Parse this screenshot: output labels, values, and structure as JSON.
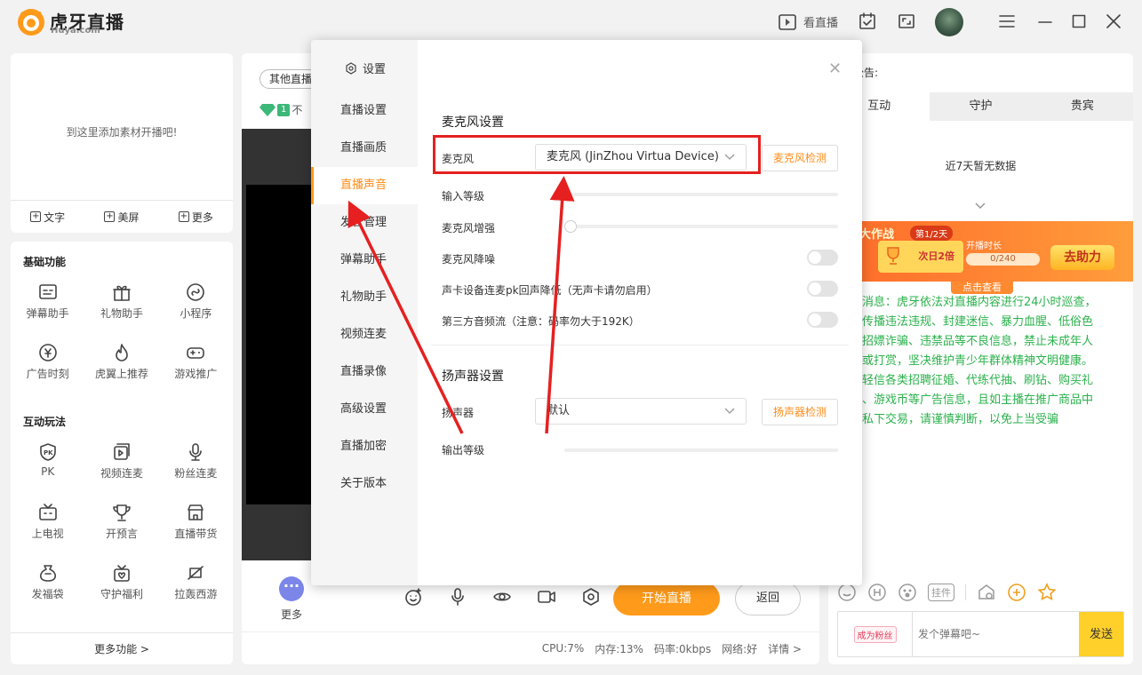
{
  "app": {
    "logo_cn": "虎牙直播",
    "logo_en": "Huya.com",
    "accent": "#ff9a1a"
  },
  "titlebar": {
    "watch_live": "看直播"
  },
  "material": {
    "hint": "到这里添加素材开播吧!",
    "tools": [
      "文字",
      "美屏",
      "更多"
    ]
  },
  "features": {
    "basic_title": "基础功能",
    "basic": [
      {
        "label": "弹幕助手",
        "icon": "danmu-icon"
      },
      {
        "label": "礼物助手",
        "icon": "gift-icon"
      },
      {
        "label": "小程序",
        "icon": "mini-program-icon"
      },
      {
        "label": "广告时刻",
        "icon": "ad-icon"
      },
      {
        "label": "虎翼上推荐",
        "icon": "flame-icon"
      },
      {
        "label": "游戏推广",
        "icon": "gamepad-icon"
      }
    ],
    "interactive_title": "互动玩法",
    "interactive": [
      {
        "label": "PK",
        "icon": "pk-icon"
      },
      {
        "label": "视频连麦",
        "icon": "video-link-icon"
      },
      {
        "label": "粉丝连麦",
        "icon": "mic-icon"
      },
      {
        "label": "上电视",
        "icon": "tv-icon"
      },
      {
        "label": "开预言",
        "icon": "trophy-icon"
      },
      {
        "label": "直播带货",
        "icon": "shop-icon"
      },
      {
        "label": "发福袋",
        "icon": "lucky-bag-icon"
      },
      {
        "label": "守护福利",
        "icon": "guard-gift-icon"
      },
      {
        "label": "拉轰西游",
        "icon": "journey-icon"
      }
    ],
    "more": "更多功能 >"
  },
  "center": {
    "other_live": "其他直播",
    "badge_num": "1",
    "badge_text": "不",
    "more_label": "更多",
    "start_live": "开始直播",
    "return": "返回",
    "status": {
      "cpu": "CPU:7%",
      "mem": "内存:13%",
      "bitrate": "码率:0kbps",
      "network": "网络:好",
      "detail": "详情 >"
    }
  },
  "right": {
    "notice": "公告:",
    "tabs": [
      "互动",
      "守护",
      "贵宾"
    ],
    "nodata": "近7天暂无数据",
    "banner": {
      "title": "福大作战",
      "stage": "第1/2天",
      "double": "次日2倍",
      "time_label": "开播时长",
      "progress_text": "0/240",
      "progress": 0,
      "help": "去助力",
      "click": "点击查看"
    },
    "sys_message": "消息：虎牙依法对直播内容进行24小时巡查，\n传播违法违规、封建迷信、暴力血腥、低俗色\n招嫖诈骗、违禁品等不良信息，禁止未成年人\n或打赏，坚决维护青少年群体精神文明健康。\n轻信各类招聘征婚、代练代抽、刷钻、购买礼\n、游戏币等广告信息，且如主播在推广商品中\n私下交易，请谨慎判断，以免上当受骗",
    "chat": {
      "fans": "成为粉丝",
      "placeholder": "发个弹幕吧~",
      "send": "发送",
      "tool_label": "挂件"
    }
  },
  "dialog": {
    "title": "设置",
    "nav": [
      "直播设置",
      "直播画质",
      "直播声音",
      "发言管理",
      "弹幕助手",
      "礼物助手",
      "视频连麦",
      "直播录像",
      "高级设置",
      "直播加密",
      "关于版本"
    ],
    "active_index": 2,
    "mic_section": "麦克风设置",
    "mic_label": "麦克风",
    "mic_device": "麦克风 (JinZhou Virtua Device)",
    "mic_test": "麦克风检测",
    "input_level": "输入等级",
    "mic_boost": "麦克风增强",
    "mic_boost_value": 0,
    "noise_reduction": "麦克风降噪",
    "noise_reduction_on": false,
    "soundcard": "声卡设备连麦pk回声降低（无声卡请勿启用）",
    "soundcard_on": false,
    "third_party": "第三方音频流（注意：码率勿大于192K）",
    "third_party_on": false,
    "speaker_section": "扬声器设置",
    "speaker_label": "扬声器",
    "speaker_device": "默认",
    "speaker_test": "扬声器检测",
    "output_level": "输出等级"
  },
  "annotation": {
    "color": "#e62020"
  }
}
